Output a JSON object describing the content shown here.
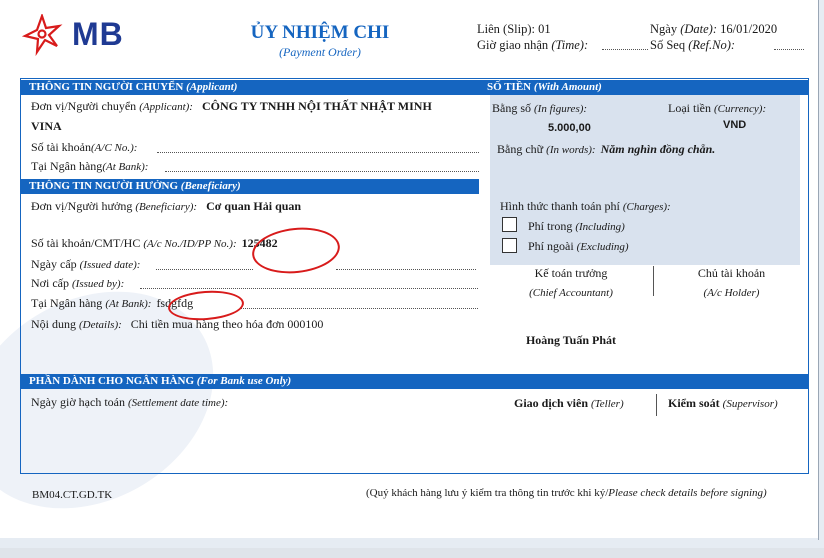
{
  "logo": {
    "text": "MB"
  },
  "header": {
    "title": "ỦY NHIỆM CHI",
    "subtitle": "(Payment Order)",
    "slip_label": "Liên (Slip): 01",
    "date_label": "Ngày",
    "date_en": "(Date):",
    "date_value": "16/01/2020",
    "time_label": "Giờ giao nhận",
    "time_en": "(Time):",
    "seq_label": "Số Seq",
    "seq_en": "(Ref.No):"
  },
  "applicant": {
    "heading": "THÔNG TIN NGƯỜI CHUYỂN",
    "heading_en": "(Applicant)",
    "unit_label": "Đơn vị/Người chuyển",
    "unit_en": "(Applicant):",
    "unit_value_1": "CÔNG TY TNHH NỘI THẤT NHẬT MINH",
    "unit_value_2": "VINA",
    "account_label": "Số tài khoản",
    "account_en": "(A/C No.):",
    "bank_label": "Tại Ngân hàng",
    "bank_en": "(At Bank):"
  },
  "amount": {
    "heading": "SỐ TIỀN",
    "heading_en": "(With Amount)",
    "figures_label": "Bằng số",
    "figures_en": "(In figures):",
    "figures_value": "5.000,00",
    "currency_label": "Loại tiền",
    "currency_en": "(Currency):",
    "currency_value": "VND",
    "words_label": "Bằng chữ",
    "words_en": "(In words):",
    "words_value": "Năm nghìn đồng chẵn.",
    "charges_label": "Hình thức thanh toán phí",
    "charges_en": "(Charges):",
    "including_label": "Phí trong",
    "including_en": "(Including)",
    "excluding_label": "Phí ngoài",
    "excluding_en": "(Excluding)"
  },
  "beneficiary": {
    "heading": "THÔNG TIN NGƯỜI HƯỞNG",
    "heading_en": "(Beneficiary)",
    "unit_label": "Đơn vị/Người hưởng",
    "unit_en": "(Beneficiary):",
    "unit_value": "Cơ quan Hải quan",
    "account_label": "Số tài khoản/CMT/HC",
    "account_en": "(A/c No./ID/PP No.):",
    "account_value": "125482",
    "issued_date_label": "Ngày cấp",
    "issued_date_en": "(Issued date):",
    "issued_by_label": "Nơi cấp",
    "issued_by_en": "(Issued by):",
    "bank_label": "Tại Ngân hàng",
    "bank_en": "(At Bank):",
    "bank_value": "fsdgfdg",
    "details_label": "Nội dung",
    "details_en": "(Details):",
    "details_value": "Chi tiền mua hàng theo hóa đơn 000100"
  },
  "signatures": {
    "chief_label": "Kế toán trưởng",
    "chief_en": "(Chief Accountant)",
    "holder_label": "Chủ tài khoản",
    "holder_en": "(A/c Holder)",
    "holder_name": "Hoàng Tuấn Phát"
  },
  "bank_use": {
    "heading": "PHẦN DÀNH CHO NGÂN HÀNG",
    "heading_en": "(For Bank use Only)",
    "settlement_label": "Ngày giờ hạch toán",
    "settlement_en": "(Settlement date time):",
    "teller_label": "Giao dịch viên",
    "teller_en": "(Teller)",
    "supervisor_label": "Kiểm soát",
    "supervisor_en": "(Supervisor)"
  },
  "footer": {
    "code": "BM04.CT.GD.TK",
    "note": "(Quý khách hàng lưu ý kiểm tra thông tin trước khi ký/",
    "note_en": "Please check details before signing)"
  },
  "colors": {
    "brand_blue": "#1565c0",
    "brand_red": "#d81b1b",
    "amount_bg": "#d9e2ee"
  }
}
